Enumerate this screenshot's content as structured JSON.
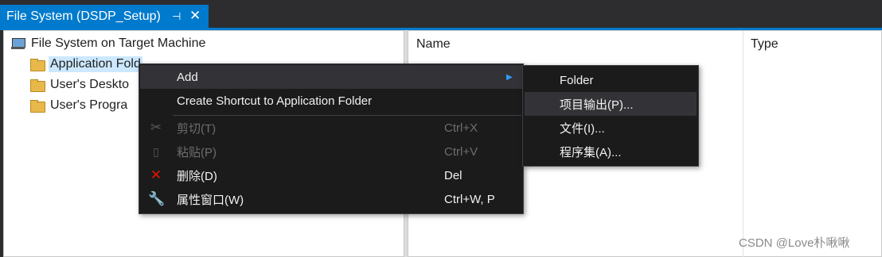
{
  "tab": {
    "title": "File System (DSDP_Setup)",
    "pin_icon": "pin-icon",
    "close_icon": "close-icon"
  },
  "tree": {
    "root": {
      "label": "File System on Target Machine",
      "icon": "computer-icon"
    },
    "items": [
      {
        "label": "Application Fold",
        "icon": "folder-open-icon",
        "selected": true
      },
      {
        "label": "User's Deskto",
        "icon": "folder-icon"
      },
      {
        "label": "User's Progra",
        "icon": "folder-icon"
      }
    ]
  },
  "columns": {
    "name": "Name",
    "type": "Type"
  },
  "context_menu": {
    "add": {
      "label": "Add",
      "arrow": "▶"
    },
    "create_shortcut": {
      "label": "Create Shortcut to Application Folder"
    },
    "cut": {
      "label": "剪切(T)",
      "shortcut": "Ctrl+X",
      "icon": "scissors-icon",
      "disabled": true
    },
    "paste": {
      "label": "粘贴(P)",
      "shortcut": "Ctrl+V",
      "icon": "clipboard-icon",
      "disabled": true
    },
    "delete": {
      "label": "删除(D)",
      "shortcut": "Del",
      "icon": "delete-x-icon"
    },
    "properties": {
      "label": "属性窗口(W)",
      "shortcut": "Ctrl+W, P",
      "icon": "wrench-icon"
    }
  },
  "submenu": {
    "folder": "Folder",
    "project_output": "项目输出(P)...",
    "file": "文件(I)...",
    "assembly": "程序集(A)..."
  },
  "watermark": "CSDN @Love朴啾啾",
  "colors": {
    "accent": "#007acc",
    "menu_bg": "#1b1b1c",
    "delete_red": "#e51400"
  }
}
